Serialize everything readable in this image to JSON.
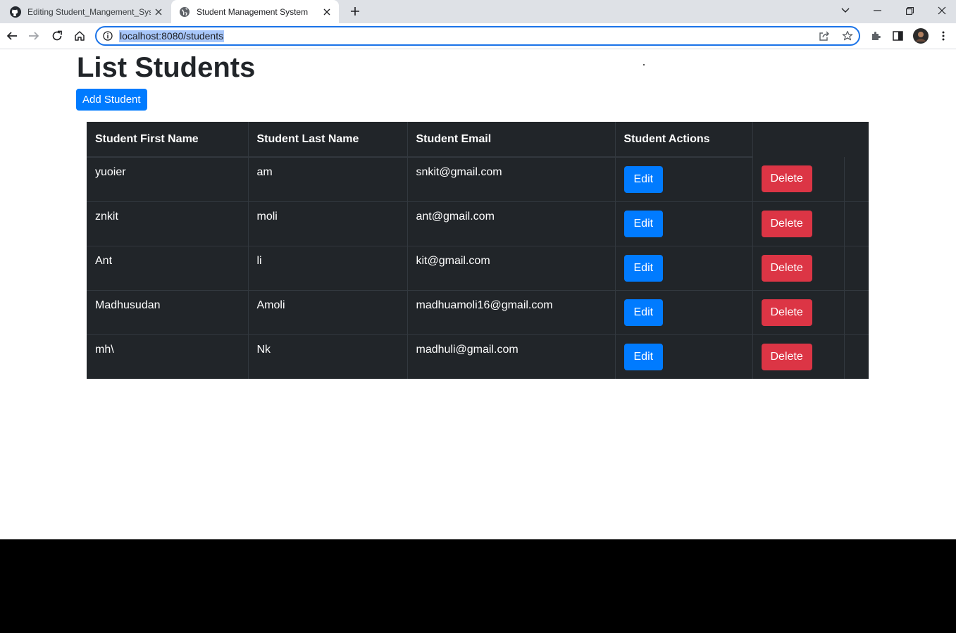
{
  "browser": {
    "tabs": [
      {
        "title": "Editing Student_Mangement_System",
        "icon": "github-icon",
        "active": false
      },
      {
        "title": "Student Management System",
        "icon": "globe-icon",
        "active": true
      }
    ],
    "url": "localhost:8080/students"
  },
  "page": {
    "title": "List Students",
    "add_button": "Add Student",
    "table": {
      "headers": [
        "Student First Name",
        "Student Last Name",
        "Student Email",
        "Student Actions"
      ],
      "rows": [
        {
          "first": "yuoier",
          "last": "am",
          "email": "snkit@gmail.com"
        },
        {
          "first": "znkit",
          "last": "moli",
          "email": "ant@gmail.com"
        },
        {
          "first": "Ant",
          "last": "li",
          "email": "kit@gmail.com"
        },
        {
          "first": "Madhusudan",
          "last": "Amoli",
          "email": "madhuamoli16@gmail.com"
        },
        {
          "first": "mh\\",
          "last": "Nk",
          "email": "madhuli@gmail.com"
        }
      ],
      "edit_label": "Edit",
      "delete_label": "Delete"
    }
  },
  "colors": {
    "primary": "#007bff",
    "danger": "#dc3545",
    "table_bg": "#212529"
  }
}
